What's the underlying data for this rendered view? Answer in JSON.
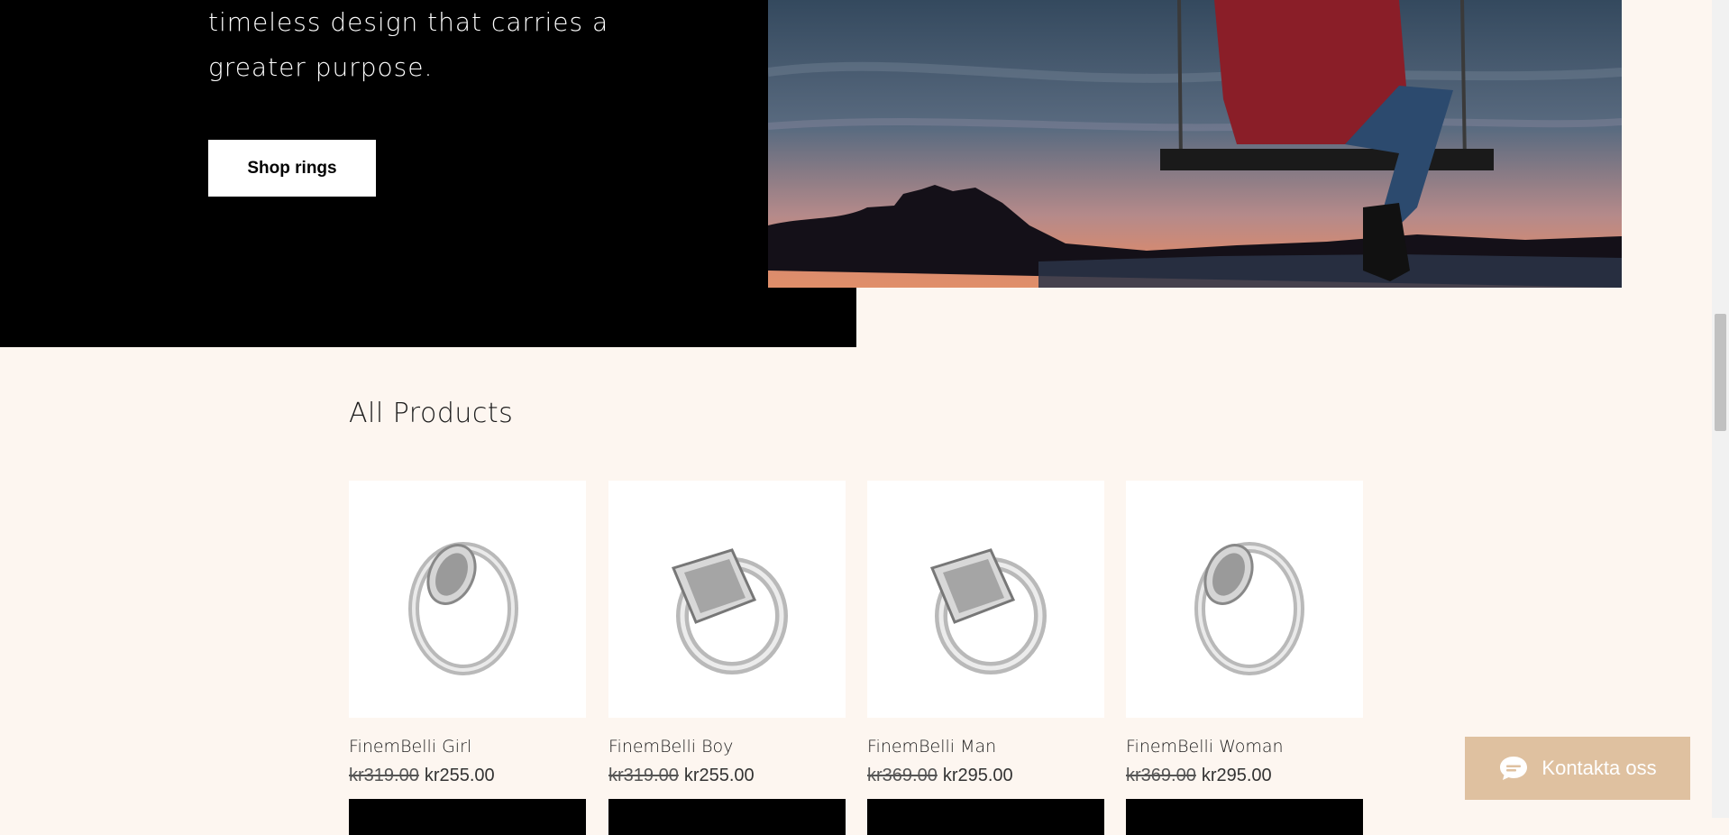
{
  "hero": {
    "text_line1": "timeless design that carries a",
    "text_line2": "greater purpose.",
    "shop_button_label": "Shop rings"
  },
  "products_section": {
    "title": "All Products",
    "items": [
      {
        "name": "FinemBelli Girl",
        "old_price": "kr319.00",
        "new_price": "kr255.00",
        "ring_style": "oval"
      },
      {
        "name": "FinemBelli Boy",
        "old_price": "kr319.00",
        "new_price": "kr255.00",
        "ring_style": "signet"
      },
      {
        "name": "FinemBelli Man",
        "old_price": "kr369.00",
        "new_price": "kr295.00",
        "ring_style": "signet"
      },
      {
        "name": "FinemBelli Woman",
        "old_price": "kr369.00",
        "new_price": "kr295.00",
        "ring_style": "oval"
      }
    ]
  },
  "chat": {
    "label": "Kontakta oss",
    "icon": "chat-bubble-icon"
  },
  "colors": {
    "page_background": "#fdf6f0",
    "hero_black": "#000000",
    "chat_button": "#dfc1a0",
    "add_to_cart_button": "#000000"
  }
}
